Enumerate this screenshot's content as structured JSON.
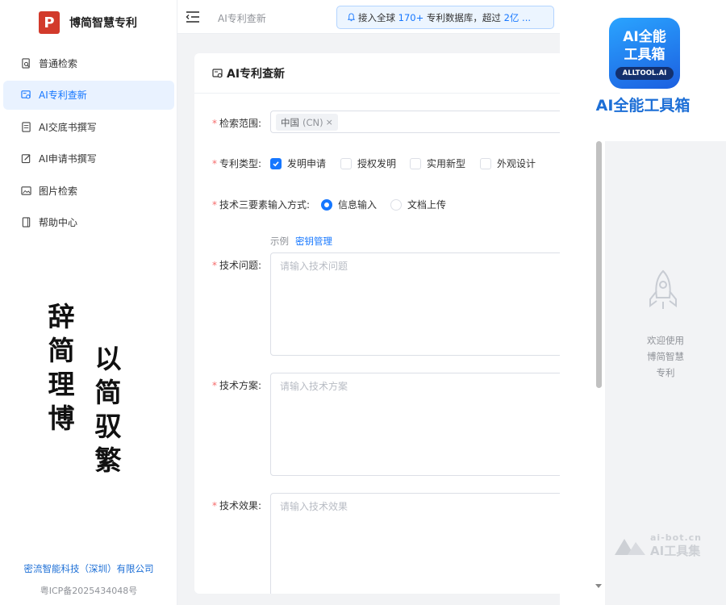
{
  "brand": {
    "logo_letter": "P",
    "name": "博简智慧专利"
  },
  "sidebar": {
    "items": [
      {
        "label": "普通检索",
        "icon": "search-doc-icon",
        "active": false
      },
      {
        "label": "AI专利查新",
        "icon": "ai-search-icon",
        "active": true
      },
      {
        "label": "AI交底书撰写",
        "icon": "doc-icon",
        "active": false
      },
      {
        "label": "AI申请书撰写",
        "icon": "edit-icon",
        "active": false
      },
      {
        "label": "图片检索",
        "icon": "image-icon",
        "active": false
      },
      {
        "label": "帮助中心",
        "icon": "help-book-icon",
        "active": false
      }
    ],
    "calligraphy": [
      "辞简理博",
      "以简驭繁"
    ],
    "footer_company": "密流智能科技（深圳）有限公司",
    "footer_icp": "粤ICP备2025434048号"
  },
  "topbar": {
    "title": "AI专利查新",
    "notice_prefix": "接入全球",
    "notice_count": "170+",
    "notice_mid": "专利数据库，超过",
    "notice_count2": "2亿 ..."
  },
  "form": {
    "title": "AI专利查新",
    "scope_label": "检索范围:",
    "scope_tag": "中国",
    "scope_tag_code": "(CN)",
    "scope_tag_remove": "×",
    "type_label": "专利类型:",
    "type_options": [
      {
        "label": "发明申请",
        "checked": true
      },
      {
        "label": "授权发明",
        "checked": false
      },
      {
        "label": "实用新型",
        "checked": false
      },
      {
        "label": "外观设计",
        "checked": false
      }
    ],
    "input_mode_label": "技术三要素输入方式:",
    "input_mode_options": [
      {
        "label": "信息输入",
        "selected": true
      },
      {
        "label": "文档上传",
        "selected": false
      }
    ],
    "example_link": "示例",
    "key_link": "密钥管理",
    "problem_label": "技术问题:",
    "problem_placeholder": "请输入技术问题",
    "solution_label": "技术方案:",
    "solution_placeholder": "请输入技术方案",
    "effect_label": "技术效果:",
    "effect_placeholder": "请输入技术效果",
    "required_mark": "*"
  },
  "right_panel": {
    "ad_logo_line1": "AI全能",
    "ad_logo_line2": "工具箱",
    "ad_logo_badge": "ALLTOOL.AI",
    "ad_name": "AI全能工具箱",
    "welcome_lines": [
      "欢迎使用",
      "博简智慧",
      "专利"
    ],
    "watermark_small": "ai-bot.cn",
    "watermark_large": "AI工具集"
  },
  "colors": {
    "primary": "#1677ff",
    "brand_red": "#d23a2b",
    "required": "#f56c6c"
  }
}
